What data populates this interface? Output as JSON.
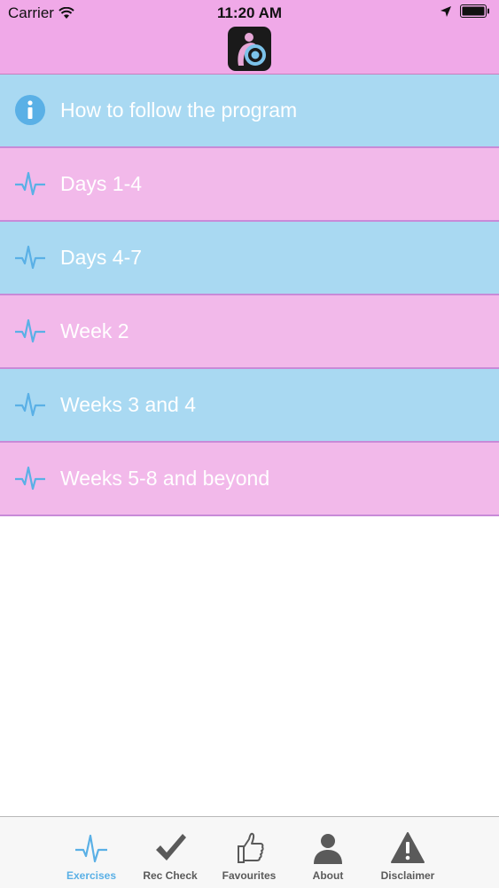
{
  "status_bar": {
    "carrier": "Carrier",
    "time": "11:20 AM"
  },
  "menu": {
    "items": [
      {
        "label": "How to follow the program",
        "icon": "info-icon",
        "color": "#a9d9f2"
      },
      {
        "label": "Days 1-4",
        "icon": "heartbeat-icon",
        "color": "#f2b9ea"
      },
      {
        "label": "Days 4-7",
        "icon": "heartbeat-icon",
        "color": "#a9d9f2"
      },
      {
        "label": "Week 2",
        "icon": "heartbeat-icon",
        "color": "#f2b9ea"
      },
      {
        "label": "Weeks 3 and 4",
        "icon": "heartbeat-icon",
        "color": "#a9d9f2"
      },
      {
        "label": "Weeks 5-8 and beyond",
        "icon": "heartbeat-icon",
        "color": "#f2b9ea"
      }
    ]
  },
  "tab_bar": {
    "tabs": [
      {
        "label": "Exercises",
        "icon": "heartbeat-icon",
        "active": true
      },
      {
        "label": "Rec Check",
        "icon": "checkmark-icon",
        "active": false
      },
      {
        "label": "Favourites",
        "icon": "thumbs-up-icon",
        "active": false
      },
      {
        "label": "About",
        "icon": "person-icon",
        "active": false
      },
      {
        "label": "Disclaimer",
        "icon": "warning-icon",
        "active": false
      }
    ]
  },
  "colors": {
    "header_bg": "#f0a9e8",
    "row_blue": "#a9d9f2",
    "row_pink": "#f2b9ea",
    "icon_blue": "#5ab0e6",
    "tab_active": "#5ab0e6",
    "tab_inactive": "#5a5a5a"
  }
}
